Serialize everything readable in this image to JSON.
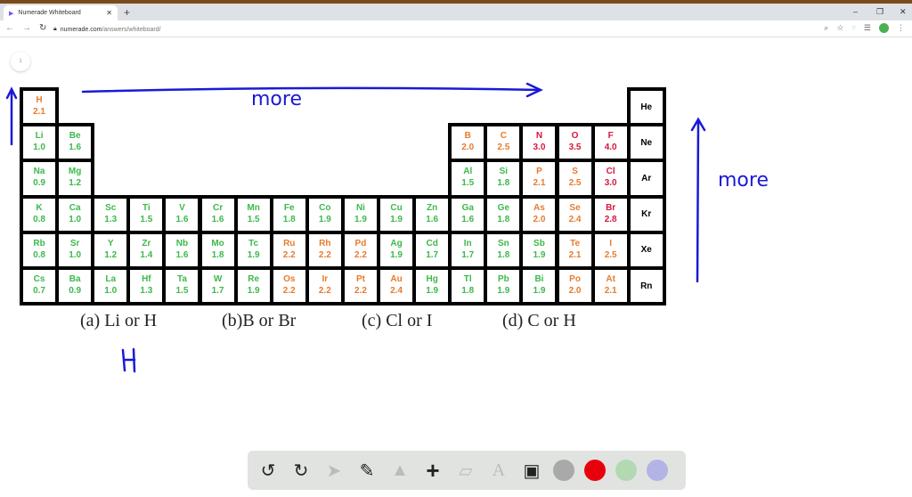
{
  "browser": {
    "tab_title": "Numerade Whiteboard",
    "url_domain": "numerade.com",
    "url_path": "/answers/whiteboard/",
    "page_number": "1"
  },
  "palette": {
    "g": "#3cb94a",
    "o": "#e87b2c",
    "r": "#d6163f",
    "k": "#000000"
  },
  "elements": [
    {
      "r": 1,
      "c": 1,
      "s": "H",
      "v": "2.1",
      "k": "o"
    },
    {
      "r": 1,
      "c": 18,
      "s": "He",
      "v": "",
      "k": "k"
    },
    {
      "r": 2,
      "c": 1,
      "s": "Li",
      "v": "1.0",
      "k": "g"
    },
    {
      "r": 2,
      "c": 2,
      "s": "Be",
      "v": "1.6",
      "k": "g"
    },
    {
      "r": 2,
      "c": 13,
      "s": "B",
      "v": "2.0",
      "k": "o"
    },
    {
      "r": 2,
      "c": 14,
      "s": "C",
      "v": "2.5",
      "k": "o"
    },
    {
      "r": 2,
      "c": 15,
      "s": "N",
      "v": "3.0",
      "k": "r"
    },
    {
      "r": 2,
      "c": 16,
      "s": "O",
      "v": "3.5",
      "k": "r"
    },
    {
      "r": 2,
      "c": 17,
      "s": "F",
      "v": "4.0",
      "k": "r"
    },
    {
      "r": 2,
      "c": 18,
      "s": "Ne",
      "v": "",
      "k": "k"
    },
    {
      "r": 3,
      "c": 1,
      "s": "Na",
      "v": "0.9",
      "k": "g"
    },
    {
      "r": 3,
      "c": 2,
      "s": "Mg",
      "v": "1.2",
      "k": "g"
    },
    {
      "r": 3,
      "c": 13,
      "s": "Al",
      "v": "1.5",
      "k": "g"
    },
    {
      "r": 3,
      "c": 14,
      "s": "Si",
      "v": "1.8",
      "k": "g"
    },
    {
      "r": 3,
      "c": 15,
      "s": "P",
      "v": "2.1",
      "k": "o"
    },
    {
      "r": 3,
      "c": 16,
      "s": "S",
      "v": "2.5",
      "k": "o"
    },
    {
      "r": 3,
      "c": 17,
      "s": "Cl",
      "v": "3.0",
      "k": "r"
    },
    {
      "r": 3,
      "c": 18,
      "s": "Ar",
      "v": "",
      "k": "k"
    },
    {
      "r": 4,
      "c": 1,
      "s": "K",
      "v": "0.8",
      "k": "g"
    },
    {
      "r": 4,
      "c": 2,
      "s": "Ca",
      "v": "1.0",
      "k": "g"
    },
    {
      "r": 4,
      "c": 3,
      "s": "Sc",
      "v": "1.3",
      "k": "g"
    },
    {
      "r": 4,
      "c": 4,
      "s": "Ti",
      "v": "1.5",
      "k": "g"
    },
    {
      "r": 4,
      "c": 5,
      "s": "V",
      "v": "1.6",
      "k": "g"
    },
    {
      "r": 4,
      "c": 6,
      "s": "Cr",
      "v": "1.6",
      "k": "g"
    },
    {
      "r": 4,
      "c": 7,
      "s": "Mn",
      "v": "1.5",
      "k": "g"
    },
    {
      "r": 4,
      "c": 8,
      "s": "Fe",
      "v": "1.8",
      "k": "g"
    },
    {
      "r": 4,
      "c": 9,
      "s": "Co",
      "v": "1.9",
      "k": "g"
    },
    {
      "r": 4,
      "c": 10,
      "s": "Ni",
      "v": "1.9",
      "k": "g"
    },
    {
      "r": 4,
      "c": 11,
      "s": "Cu",
      "v": "1.9",
      "k": "g"
    },
    {
      "r": 4,
      "c": 12,
      "s": "Zn",
      "v": "1.6",
      "k": "g"
    },
    {
      "r": 4,
      "c": 13,
      "s": "Ga",
      "v": "1.6",
      "k": "g"
    },
    {
      "r": 4,
      "c": 14,
      "s": "Ge",
      "v": "1.8",
      "k": "g"
    },
    {
      "r": 4,
      "c": 15,
      "s": "As",
      "v": "2.0",
      "k": "o"
    },
    {
      "r": 4,
      "c": 16,
      "s": "Se",
      "v": "2.4",
      "k": "o"
    },
    {
      "r": 4,
      "c": 17,
      "s": "Br",
      "v": "2.8",
      "k": "r"
    },
    {
      "r": 4,
      "c": 18,
      "s": "Kr",
      "v": "",
      "k": "k"
    },
    {
      "r": 5,
      "c": 1,
      "s": "Rb",
      "v": "0.8",
      "k": "g"
    },
    {
      "r": 5,
      "c": 2,
      "s": "Sr",
      "v": "1.0",
      "k": "g"
    },
    {
      "r": 5,
      "c": 3,
      "s": "Y",
      "v": "1.2",
      "k": "g"
    },
    {
      "r": 5,
      "c": 4,
      "s": "Zr",
      "v": "1.4",
      "k": "g"
    },
    {
      "r": 5,
      "c": 5,
      "s": "Nb",
      "v": "1.6",
      "k": "g"
    },
    {
      "r": 5,
      "c": 6,
      "s": "Mo",
      "v": "1.8",
      "k": "g"
    },
    {
      "r": 5,
      "c": 7,
      "s": "Tc",
      "v": "1.9",
      "k": "g"
    },
    {
      "r": 5,
      "c": 8,
      "s": "Ru",
      "v": "2.2",
      "k": "o"
    },
    {
      "r": 5,
      "c": 9,
      "s": "Rh",
      "v": "2.2",
      "k": "o"
    },
    {
      "r": 5,
      "c": 10,
      "s": "Pd",
      "v": "2.2",
      "k": "o"
    },
    {
      "r": 5,
      "c": 11,
      "s": "Ag",
      "v": "1.9",
      "k": "g"
    },
    {
      "r": 5,
      "c": 12,
      "s": "Cd",
      "v": "1.7",
      "k": "g"
    },
    {
      "r": 5,
      "c": 13,
      "s": "In",
      "v": "1.7",
      "k": "g"
    },
    {
      "r": 5,
      "c": 14,
      "s": "Sn",
      "v": "1.8",
      "k": "g"
    },
    {
      "r": 5,
      "c": 15,
      "s": "Sb",
      "v": "1.9",
      "k": "g"
    },
    {
      "r": 5,
      "c": 16,
      "s": "Te",
      "v": "2.1",
      "k": "o"
    },
    {
      "r": 5,
      "c": 17,
      "s": "I",
      "v": "2.5",
      "k": "o"
    },
    {
      "r": 5,
      "c": 18,
      "s": "Xe",
      "v": "",
      "k": "k"
    },
    {
      "r": 6,
      "c": 1,
      "s": "Cs",
      "v": "0.7",
      "k": "g"
    },
    {
      "r": 6,
      "c": 2,
      "s": "Ba",
      "v": "0.9",
      "k": "g"
    },
    {
      "r": 6,
      "c": 3,
      "s": "La",
      "v": "1.0",
      "k": "g"
    },
    {
      "r": 6,
      "c": 4,
      "s": "Hf",
      "v": "1.3",
      "k": "g"
    },
    {
      "r": 6,
      "c": 5,
      "s": "Ta",
      "v": "1.5",
      "k": "g"
    },
    {
      "r": 6,
      "c": 6,
      "s": "W",
      "v": "1.7",
      "k": "g"
    },
    {
      "r": 6,
      "c": 7,
      "s": "Re",
      "v": "1.9",
      "k": "g"
    },
    {
      "r": 6,
      "c": 8,
      "s": "Os",
      "v": "2.2",
      "k": "o"
    },
    {
      "r": 6,
      "c": 9,
      "s": "Ir",
      "v": "2.2",
      "k": "o"
    },
    {
      "r": 6,
      "c": 10,
      "s": "Pt",
      "v": "2.2",
      "k": "o"
    },
    {
      "r": 6,
      "c": 11,
      "s": "Au",
      "v": "2.4",
      "k": "o"
    },
    {
      "r": 6,
      "c": 12,
      "s": "Hg",
      "v": "1.9",
      "k": "g"
    },
    {
      "r": 6,
      "c": 13,
      "s": "Tl",
      "v": "1.8",
      "k": "g"
    },
    {
      "r": 6,
      "c": 14,
      "s": "Pb",
      "v": "1.9",
      "k": "g"
    },
    {
      "r": 6,
      "c": 15,
      "s": "Bi",
      "v": "1.9",
      "k": "g"
    },
    {
      "r": 6,
      "c": 16,
      "s": "Po",
      "v": "2.0",
      "k": "o"
    },
    {
      "r": 6,
      "c": 17,
      "s": "At",
      "v": "2.1",
      "k": "o"
    },
    {
      "r": 6,
      "c": 18,
      "s": "Rn",
      "v": "",
      "k": "k"
    }
  ],
  "questions": {
    "a": "(a) Li or H",
    "b": "(b)B or Br",
    "c": "(c) Cl or I",
    "d": "(d) C or H"
  },
  "handwriting": {
    "top_arrow": "more",
    "side_arrow": "more",
    "answer_a": "H"
  },
  "toolbar": {
    "colors": [
      "#a9a9a9",
      "#e8000b",
      "#b3d9b3",
      "#b3b3e6"
    ]
  }
}
